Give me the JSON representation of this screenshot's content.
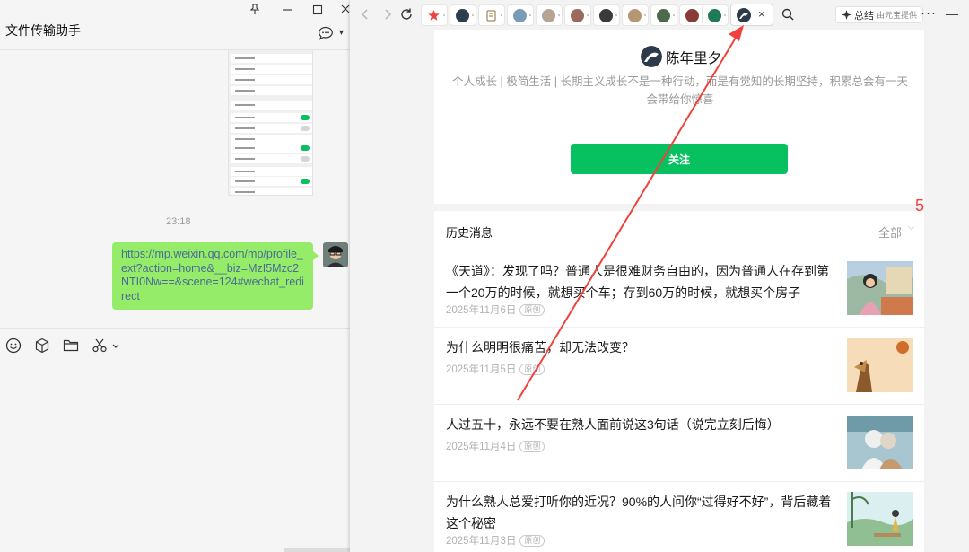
{
  "chat": {
    "title": "文件传输助手",
    "time": "23:18",
    "message": "https://mp.weixin.qq.com/mp/profile_ext?action=home&__biz=MzI5Mzc2NTI0Nw==&scene=124#wechat_redirect",
    "window_icons": [
      "pin-icon",
      "minimize-icon",
      "maximize-icon",
      "close-icon"
    ],
    "toolbar_icons": [
      "emoji-icon",
      "box-icon",
      "folder-icon",
      "scissors-icon"
    ]
  },
  "browser": {
    "summary_label": "总结",
    "summary_sub": "由元宝提供",
    "tab_close": "×",
    "more": "···",
    "minimize": "—",
    "tab_colors": [
      "#e8463d",
      "#2c3e50",
      "#8a6d3b",
      "#7a9bb5",
      "#b5a393",
      "#9b6a5f",
      "#3a3a3a",
      "#b59672",
      "#4d6b4a",
      "#8b3a3a",
      "#1f7a55"
    ]
  },
  "profile": {
    "name": "陈年里夕",
    "description": "个人成长 | 极简生活 | 长期主义成长不是一种行动，而是有觉知的长期坚持，积累总会有一天会带给你惊喜",
    "follow_label": "关注"
  },
  "history": {
    "title": "历史消息",
    "filter_label": "全部",
    "articles": [
      {
        "title": "《天道》：发现了吗？普通人是很难财务自由的，因为普通人在存到第一个20万的时候，就想买个车；存到60万的时候，就想买个房子",
        "date": "2025年11月6日",
        "badge": "原创"
      },
      {
        "title": "为什么明明很痛苦，却无法改变？",
        "date": "2025年11月5日",
        "badge": "原创"
      },
      {
        "title": "人过五十，永远不要在熟人面前说这3句话（说完立刻后悔）",
        "date": "2025年11月4日",
        "badge": "原创"
      },
      {
        "title": "为什么熟人总爱打听你的近况？90%的人问你“过得好不好”，背后藏着这个秘密",
        "date": "2025年11月3日",
        "badge": "原创"
      }
    ]
  },
  "annotation": {
    "number": "5",
    "color": "#f2413c"
  }
}
